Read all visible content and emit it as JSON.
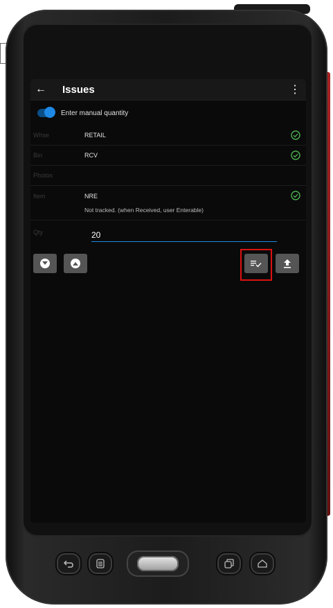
{
  "app": {
    "title": "Issues"
  },
  "settings": {
    "manual_quantity_label": "Enter manual quantity",
    "manual_quantity_on": true
  },
  "fields": {
    "whse": {
      "label": "Whse",
      "value": "RETAIL",
      "valid": true
    },
    "bin": {
      "label": "Bin",
      "value": "RCV",
      "valid": true
    },
    "photos": {
      "label": "Photos"
    },
    "item": {
      "label": "Item",
      "value": "NRE",
      "note": "Not tracked. (when Received, user Enterable)",
      "valid": true
    },
    "qty": {
      "label": "Qty",
      "value": "20"
    }
  },
  "actions": {
    "icons": [
      "arrow-down-icon",
      "arrow-up-icon",
      "list-check-icon",
      "upload-icon"
    ],
    "highlight_color": "#dd1111"
  },
  "colors": {
    "accent": "#1e88e5",
    "valid": "#4caf50",
    "screen_bg": "#0a0a0a"
  }
}
